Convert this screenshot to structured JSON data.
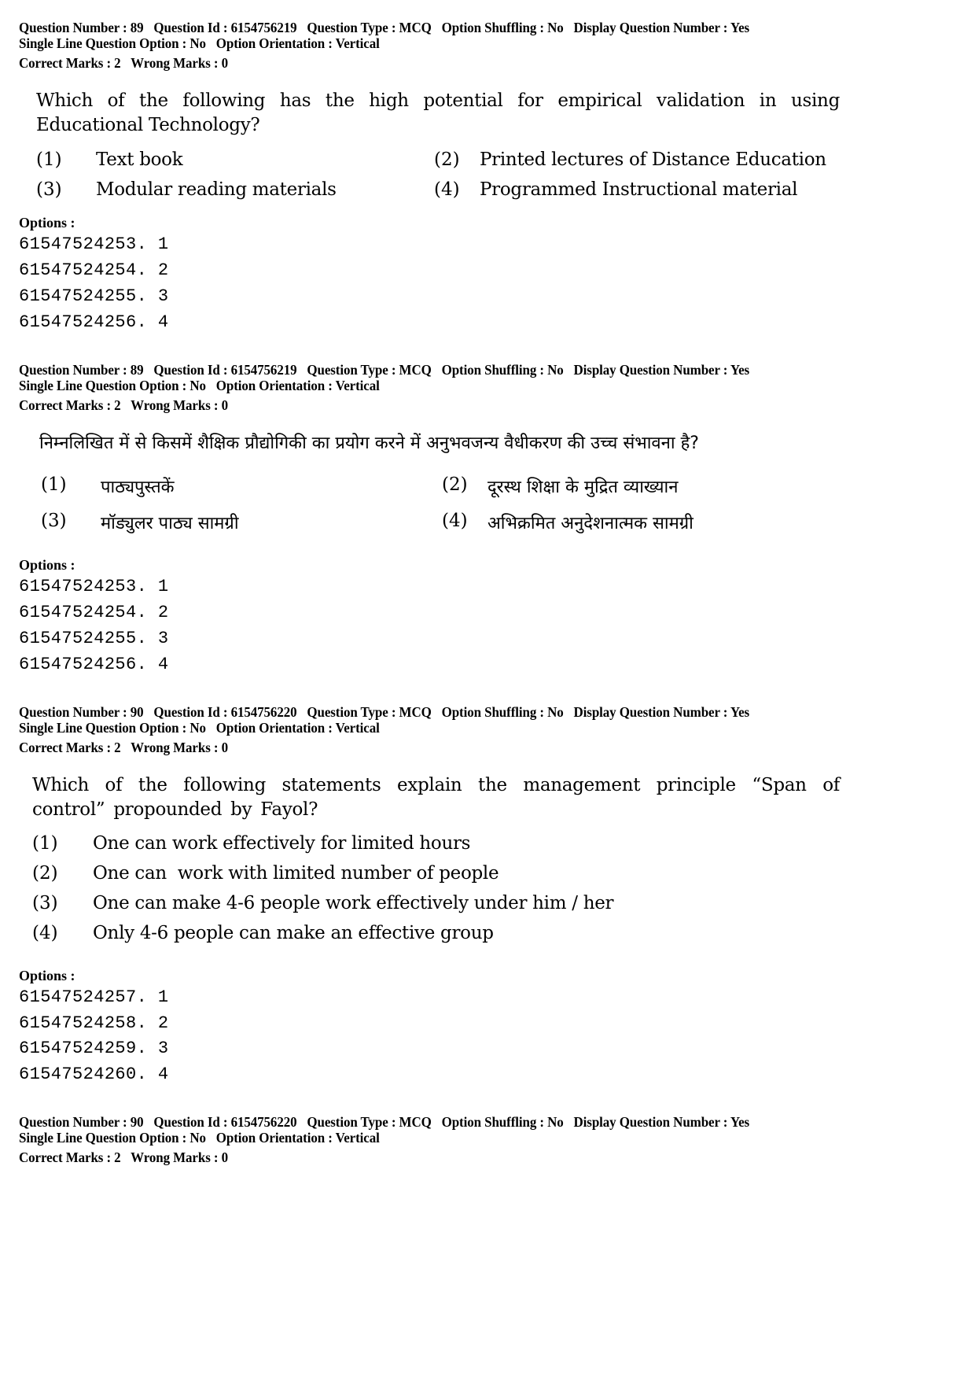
{
  "blocks": [
    {
      "meta_line1": {
        "question_number": "Question Number : 89",
        "question_id": "Question Id : 6154756219",
        "question_type": "Question Type : MCQ",
        "option_shuffling": "Option Shuffling : No",
        "display_question_number": "Display Question Number : Yes"
      },
      "meta_line2": {
        "single_line": "Single Line Question Option : No",
        "orientation": "Option Orientation : Vertical"
      },
      "marks": {
        "correct": "Correct Marks : 2",
        "wrong": "Wrong Marks : 0"
      },
      "question": "Which of the following has the high potential for empirical validation in using Educational Technology?",
      "choices": [
        {
          "num": "(1)",
          "text": "Text book"
        },
        {
          "num": "(2)",
          "text": "Printed lectures of Distance Education"
        },
        {
          "num": "(3)",
          "text": "Modular reading materials"
        },
        {
          "num": "(4)",
          "text": "Programmed Instructional material"
        }
      ],
      "options_label": "Options :",
      "option_ids": [
        "61547524253. 1",
        "61547524254. 2",
        "61547524255. 3",
        "61547524256. 4"
      ]
    },
    {
      "meta_line1": {
        "question_number": "Question Number : 89",
        "question_id": "Question Id : 6154756219",
        "question_type": "Question Type : MCQ",
        "option_shuffling": "Option Shuffling : No",
        "display_question_number": "Display Question Number : Yes"
      },
      "meta_line2": {
        "single_line": "Single Line Question Option : No",
        "orientation": "Option Orientation : Vertical"
      },
      "marks": {
        "correct": "Correct Marks : 2",
        "wrong": "Wrong Marks : 0"
      },
      "question": "निम्नलिखित में से  किसमें शैक्षिक प्रौद्योगिकी का प्रयोग करने में अनुभवजन्य वैधीकरण की उच्च संभावना है?",
      "choices": [
        {
          "num": "(1)",
          "text": "पाठ्यपुस्तकें"
        },
        {
          "num": "(2)",
          "text": "दूरस्थ शिक्षा के मुद्रित व्याख्यान"
        },
        {
          "num": "(3)",
          "text": "मॉड्युलर पाठ्य सामग्री"
        },
        {
          "num": "(4)",
          "text": "अभिक्रमित अनुदेशनात्मक सामग्री"
        }
      ],
      "options_label": "Options :",
      "option_ids": [
        "61547524253. 1",
        "61547524254. 2",
        "61547524255. 3",
        "61547524256. 4"
      ]
    },
    {
      "meta_line1": {
        "question_number": "Question Number : 90",
        "question_id": "Question Id : 6154756220",
        "question_type": "Question Type : MCQ",
        "option_shuffling": "Option Shuffling : No",
        "display_question_number": "Display Question Number : Yes"
      },
      "meta_line2": {
        "single_line": "Single Line Question Option : No",
        "orientation": "Option Orientation : Vertical"
      },
      "marks": {
        "correct": "Correct Marks : 2",
        "wrong": "Wrong Marks : 0"
      },
      "question": "Which of the following statements explain the management principle “Span of control” propounded by Fayol?",
      "choices": [
        {
          "num": "(1)",
          "text": "One can work effectively for limited hours"
        },
        {
          "num": "(2)",
          "text": "One can  work with limited number of people"
        },
        {
          "num": "(3)",
          "text": "One can make 4-6 people work effectively under him / her"
        },
        {
          "num": "(4)",
          "text": "Only 4-6 people can make an effective group"
        }
      ],
      "options_label": "Options :",
      "option_ids": [
        "61547524257. 1",
        "61547524258. 2",
        "61547524259. 3",
        "61547524260. 4"
      ]
    },
    {
      "meta_line1": {
        "question_number": "Question Number : 90",
        "question_id": "Question Id : 6154756220",
        "question_type": "Question Type : MCQ",
        "option_shuffling": "Option Shuffling : No",
        "display_question_number": "Display Question Number : Yes"
      },
      "meta_line2": {
        "single_line": "Single Line Question Option : No",
        "orientation": "Option Orientation : Vertical"
      },
      "marks": {
        "correct": "Correct Marks : 2",
        "wrong": "Wrong Marks : 0"
      }
    }
  ]
}
